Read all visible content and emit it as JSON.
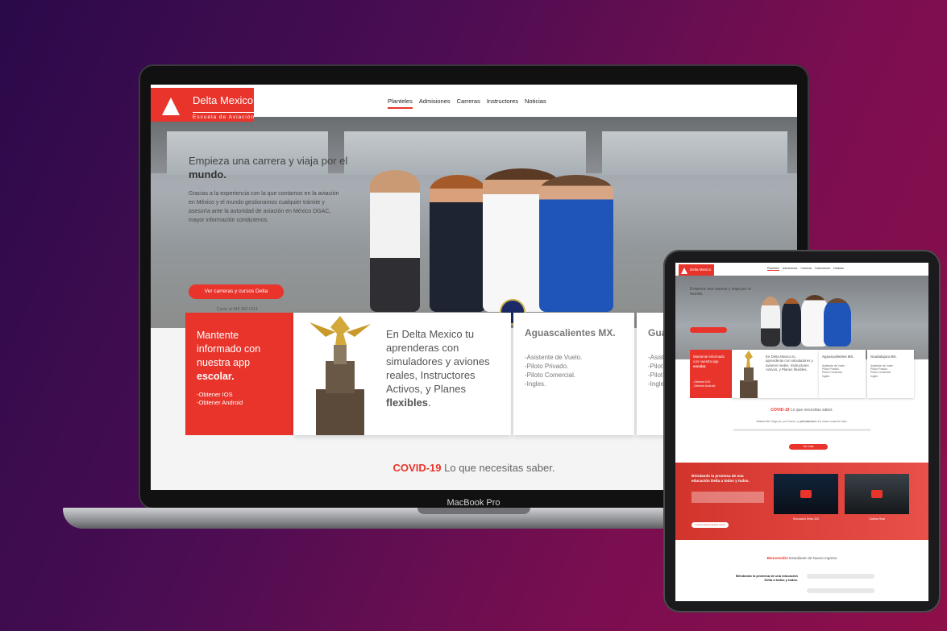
{
  "laptop": {
    "device_label": "MacBook Pro",
    "brand": {
      "name": "Delta Mexico",
      "tagline": "Escuela de Aviación"
    },
    "nav": [
      "Planteles",
      "Admisiones",
      "Carreras",
      "Instructores",
      "Noticias"
    ],
    "hero": {
      "title_line": "Empieza una carrera y viaja por el",
      "title_bold": "mundo.",
      "text": "Gracias a la experiencia con la que contamos en la aviación en México y el mundo gestionamos cualquier trámite y asesoría ante la autoridad de aviación en México DGAC, mayor información contáctenos.",
      "button": "Ver carreras y cursos Delta",
      "small": "Curso al 449 269 1414"
    },
    "app_card": {
      "title": "Mantente informado con nuestra app",
      "title_bold": "escolar.",
      "links": [
        "-Obtener IOS",
        "-Obtener Android"
      ]
    },
    "promo_card": {
      "text": "En Delta Mexico tu aprenderas con simuladores y aviones reales, Instructores Activos, y Planes",
      "bold": "flexibles",
      "tail": "."
    },
    "campus_cards": [
      {
        "name": "Aguascalientes MX.",
        "items": "-Asistente de Vuelo.\n-Piloto Privado.\n-Piloto Comercial.\n-Ingles."
      },
      {
        "name": "Gua",
        "items": "-Asist\n-Pilot\n-Pilot\n-Ingle"
      }
    ],
    "covid": {
      "bold": "COVID-19",
      "rest": " Lo que necesitas saber."
    }
  },
  "tablet": {
    "brand": "Delta Mexico",
    "nav": [
      "Planteles",
      "Admisiones",
      "Carreras",
      "Instructores",
      "Noticias"
    ],
    "hero_title": "Empieza una carrera y viaja por el mundo.",
    "app_card": {
      "title": "Mantente informado con nuestra app",
      "bold": "escolar.",
      "links": "-Obtener IOS\n-Obtener Android"
    },
    "promo": "En Delta Mexico tu aprenderas con simuladores y aviones reales, Instructores Activos, y Planes flexibles.",
    "campus": [
      {
        "name": "Aguascalientes MX.",
        "items": "Asistente de Vuelo\nPiloto Privado\nPiloto Comercial\nIngles"
      },
      {
        "name": "Guadalajara MX.",
        "items": "Asistente de Vuelo\nPiloto Privado\nPiloto Comercial\nIngles"
      }
    ],
    "covid": {
      "bold": "COVID-19",
      "rest": " Lo que necesitas saber."
    },
    "covid_sub": {
      "pre": "Mantente Seguro, por favor, y",
      "bold": "permanece",
      "post": " en casa cuando sea."
    },
    "covid_btn": "Ver más",
    "red_section": {
      "title": "Brindando la promesa de una educación Delta a todos y todos.",
      "button": "Conoce más de nuestros cursos",
      "videos": [
        {
          "caption": "Simulador Delta 320"
        },
        {
          "caption": "Cabina Real"
        }
      ]
    },
    "welcome": {
      "bold": "Bienvenido!",
      "rest": " Estudiante de Nuevo Ingreso"
    },
    "bottom_title": "Brindando la promesa de una educación Delta a todos y todos."
  },
  "colors": {
    "accent": "#e8342b",
    "bg_start": "#2a0a4a",
    "bg_end": "#8e0f4a"
  }
}
